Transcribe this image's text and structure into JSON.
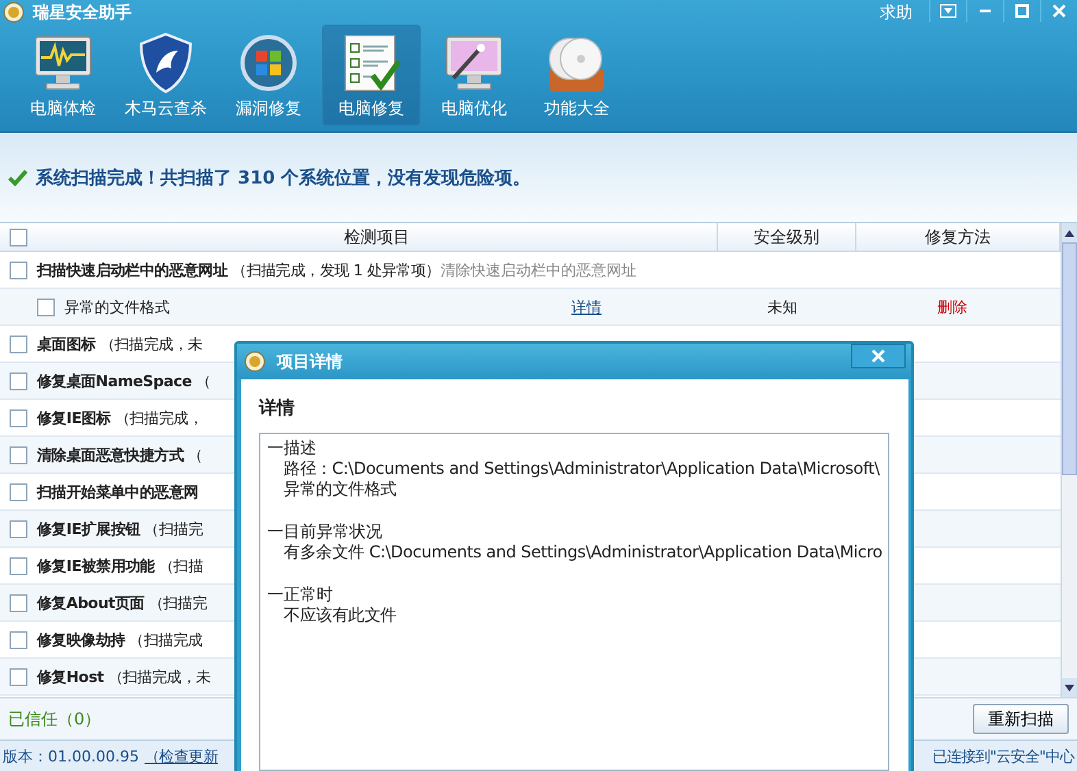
{
  "window": {
    "title": "瑞星安全助手",
    "help": "求助"
  },
  "toolbar": [
    {
      "label": "电脑体检",
      "kind": "monitor",
      "selected": false
    },
    {
      "label": "木马云查杀",
      "kind": "shield",
      "selected": false
    },
    {
      "label": "漏洞修复",
      "kind": "update",
      "selected": false
    },
    {
      "label": "电脑修复",
      "kind": "checklist",
      "selected": true
    },
    {
      "label": "电脑优化",
      "kind": "wand",
      "selected": false
    },
    {
      "label": "功能大全",
      "kind": "discs",
      "selected": false
    }
  ],
  "status": {
    "message": "系统扫描完成！共扫描了 310 个系统位置，没有发现危险项。"
  },
  "table": {
    "select_all": {
      "checked": false
    },
    "columns": [
      "检测项目",
      "安全级别",
      "修复方法"
    ],
    "rows": [
      {
        "kind": "group",
        "checked": false,
        "name": "扫描快速启动栏中的恶意网址",
        "status": "（扫描完成，发现 1 处异常项）",
        "action": "清除快速启动栏中的恶意网址"
      },
      {
        "kind": "item",
        "checked": false,
        "name": "异常的文件格式",
        "link": "详情",
        "safety": "未知",
        "fix": "删除"
      },
      {
        "kind": "group",
        "checked": false,
        "name": "桌面图标",
        "status": "（扫描完成，未"
      },
      {
        "kind": "group",
        "checked": false,
        "name": "修复桌面NameSpace",
        "status": "（"
      },
      {
        "kind": "group",
        "checked": false,
        "name": "修复IE图标",
        "status": "（扫描完成，"
      },
      {
        "kind": "group",
        "checked": false,
        "name": "清除桌面恶意快捷方式",
        "status": "（"
      },
      {
        "kind": "group",
        "checked": false,
        "name": "扫描开始菜单中的恶意网"
      },
      {
        "kind": "group",
        "checked": false,
        "name": "修复IE扩展按钮",
        "status": "（扫描完"
      },
      {
        "kind": "group",
        "checked": false,
        "name": "修复IE被禁用功能",
        "status": "（扫描"
      },
      {
        "kind": "group",
        "checked": false,
        "name": "修复About页面",
        "status": "（扫描完"
      },
      {
        "kind": "group",
        "checked": false,
        "name": "修复映像劫持",
        "status": "（扫描完成"
      },
      {
        "kind": "group",
        "checked": false,
        "name": "修复Host",
        "status": "（扫描完成，未"
      }
    ]
  },
  "footer": {
    "trusted": "已信任（0）",
    "rescan_button": "重新扫描"
  },
  "status_bar": {
    "version": "版本：01.00.00.95",
    "update_link": "（检查更新",
    "connection": "已连接到\"云安全\"中心"
  },
  "dialog": {
    "title": "项目详情",
    "heading": "详情",
    "sections": [
      {
        "title": "一描述",
        "lines": [
          "路径：C:\\Documents and Settings\\Administrator\\Application Data\\Microsoft\\",
          "异常的文件格式"
        ]
      },
      {
        "title": "一目前异常状况",
        "lines": [
          "有多余文件  C:\\Documents and Settings\\Administrator\\Application Data\\Micro"
        ]
      },
      {
        "title": "一正常时",
        "lines": [
          "不应该有此文件"
        ]
      }
    ]
  }
}
